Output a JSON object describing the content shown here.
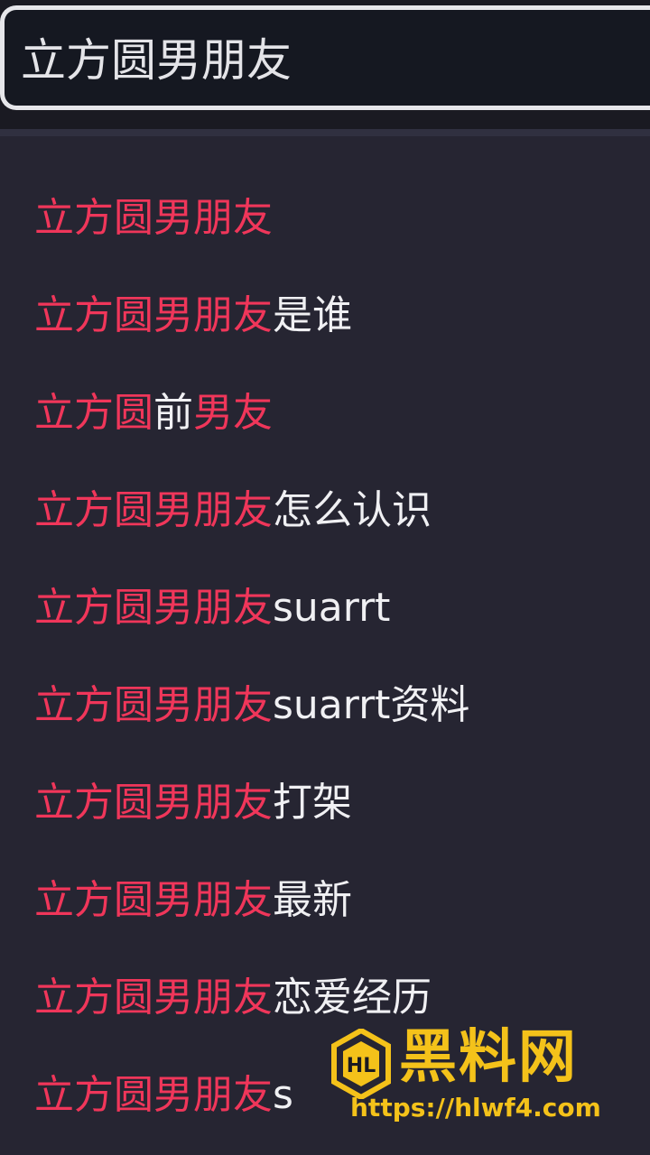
{
  "search": {
    "query": "立方圆男朋友"
  },
  "suggestions": [
    {
      "parts": [
        {
          "t": "立方圆男朋友",
          "hl": true
        }
      ]
    },
    {
      "parts": [
        {
          "t": "立方圆男朋友",
          "hl": true
        },
        {
          "t": "是谁",
          "hl": false
        }
      ]
    },
    {
      "parts": [
        {
          "t": "立方圆",
          "hl": true
        },
        {
          "t": "前",
          "hl": false
        },
        {
          "t": "男友",
          "hl": true
        }
      ]
    },
    {
      "parts": [
        {
          "t": "立方圆男朋友",
          "hl": true
        },
        {
          "t": "怎么认识",
          "hl": false
        }
      ]
    },
    {
      "parts": [
        {
          "t": "立方圆男朋友",
          "hl": true
        },
        {
          "t": "suarrt",
          "hl": false
        }
      ]
    },
    {
      "parts": [
        {
          "t": "立方圆男朋友",
          "hl": true
        },
        {
          "t": "suarrt资料",
          "hl": false
        }
      ]
    },
    {
      "parts": [
        {
          "t": "立方圆男朋友",
          "hl": true
        },
        {
          "t": "打架",
          "hl": false
        }
      ]
    },
    {
      "parts": [
        {
          "t": "立方圆男朋友",
          "hl": true
        },
        {
          "t": "最新",
          "hl": false
        }
      ]
    },
    {
      "parts": [
        {
          "t": "立方圆男朋友",
          "hl": true
        },
        {
          "t": "恋爱经历",
          "hl": false
        }
      ]
    },
    {
      "parts": [
        {
          "t": "立方圆男朋友",
          "hl": true
        },
        {
          "t": "s",
          "hl": false
        }
      ]
    }
  ],
  "watermark": {
    "title": "黑料网",
    "url": "https://hlwf4.com",
    "logo_text": "HL"
  },
  "colors": {
    "background": "#262532",
    "highlight": "#f0365a",
    "text": "#f0f0f3",
    "watermark": "#f4c21a"
  }
}
